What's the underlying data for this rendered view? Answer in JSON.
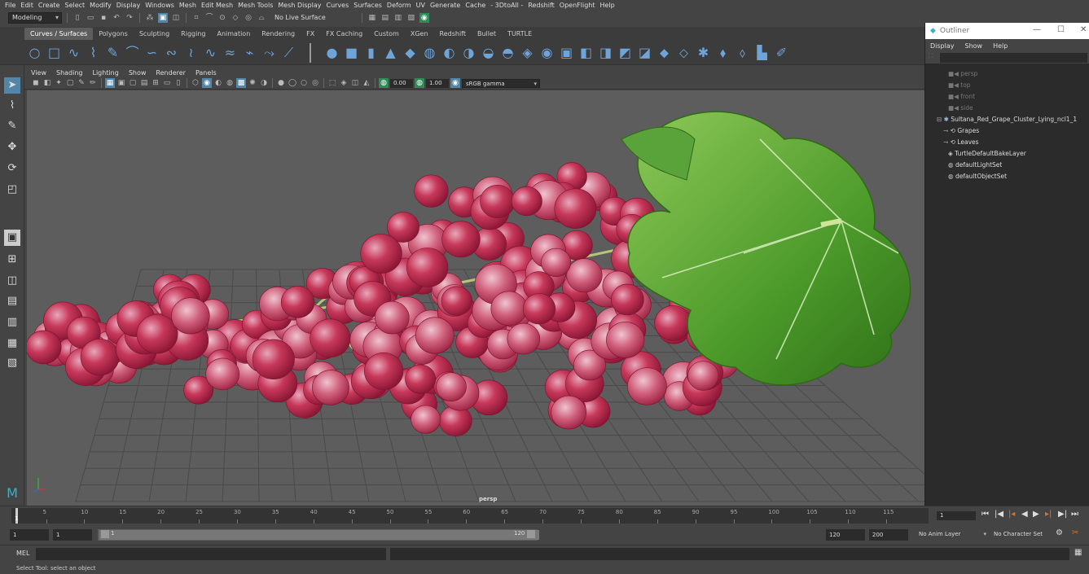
{
  "menu": [
    "File",
    "Edit",
    "Create",
    "Select",
    "Modify",
    "Display",
    "Windows",
    "Mesh",
    "Edit Mesh",
    "Mesh Tools",
    "Mesh Display",
    "Curves",
    "Surfaces",
    "Deform",
    "UV",
    "Generate",
    "Cache",
    "- 3DtoAll -",
    "Redshift",
    "OpenFlight",
    "Help"
  ],
  "status": {
    "mode": "Modeling",
    "live_surface": "No Live Surface"
  },
  "shelf_tabs": [
    "Curves / Surfaces",
    "Polygons",
    "Sculpting",
    "Rigging",
    "Animation",
    "Rendering",
    "FX",
    "FX Caching",
    "Custom",
    "XGen",
    "Redshift",
    "Bullet",
    "TURTLE"
  ],
  "panel_menu": [
    "View",
    "Shading",
    "Lighting",
    "Show",
    "Renderer",
    "Panels"
  ],
  "panel_toolbar": {
    "near": "0.00",
    "far": "1.00",
    "color_space": "sRGB gamma"
  },
  "viewport": {
    "camera": "persp"
  },
  "outliner": {
    "title": "Outliner",
    "menu": [
      "Display",
      "Show",
      "Help"
    ],
    "items": [
      "persp",
      "top",
      "front",
      "side",
      "Sultana_Red_Grape_Cluster_Lying_ncl1_1",
      "Grapes",
      "Leaves",
      "TurtleDefaultBakeLayer",
      "defaultLightSet",
      "defaultObjectSet"
    ]
  },
  "timeline": {
    "ticks": [
      5,
      10,
      15,
      20,
      25,
      30,
      35,
      40,
      45,
      50,
      55,
      60,
      65,
      70,
      75,
      80,
      85,
      90,
      95,
      100,
      105,
      110,
      115
    ],
    "current_frame": "1",
    "first_label": "1"
  },
  "range": {
    "start": "1",
    "start2": "1",
    "slider_start": "1",
    "slider_end": "120",
    "end": "120",
    "end2": "200",
    "anim_layer": "No Anim Layer",
    "char_set": "No Character Set"
  },
  "command": {
    "label": "MEL"
  },
  "help": "Select Tool: select an object",
  "colors": {
    "accent": "#5285a6",
    "viewport": "#5d5d5d",
    "grape": "#c2304f",
    "leaf": "#4c9a2a"
  }
}
